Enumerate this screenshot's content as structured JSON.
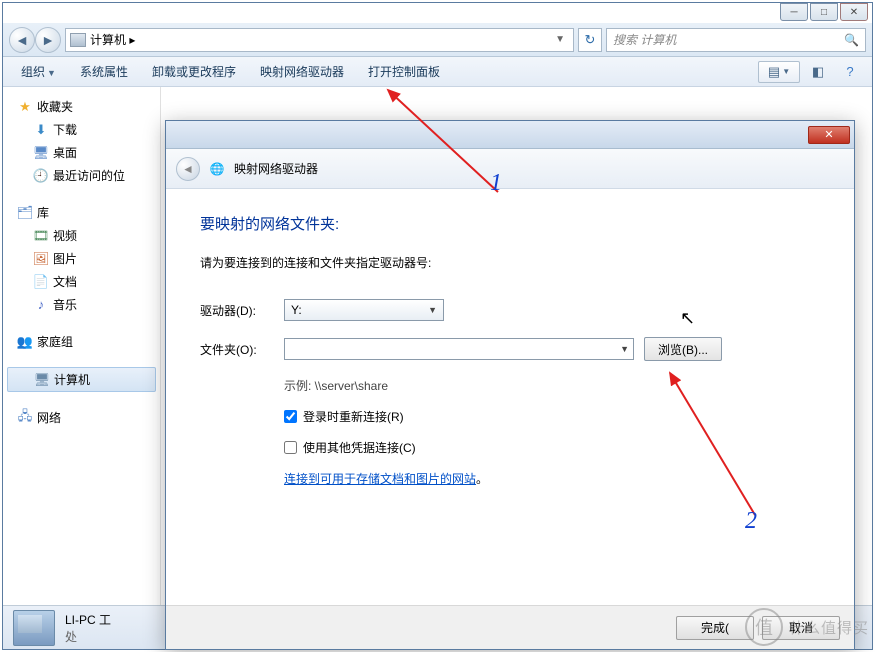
{
  "explorer": {
    "addr_icon_label": "计算机",
    "addr_text": "计算机 ▸",
    "search_placeholder": "搜索 计算机",
    "toolbar": {
      "organize": "组织",
      "properties": "系统属性",
      "uninstall": "卸载或更改程序",
      "mapdrive": "映射网络驱动器",
      "controlpanel": "打开控制面板"
    },
    "sidebar": {
      "favorites": "收藏夹",
      "downloads": "下载",
      "desktop": "桌面",
      "recent": "最近访问的位",
      "libraries": "库",
      "videos": "视频",
      "pictures": "图片",
      "documents": "文档",
      "music": "音乐",
      "homegroup": "家庭组",
      "computer": "计算机",
      "network": "网络"
    },
    "status": {
      "name": "LI-PC 工",
      "sub": "处"
    }
  },
  "dialog": {
    "header_title": "映射网络驱动器",
    "heading": "要映射的网络文件夹:",
    "instruction": "请为要连接到的连接和文件夹指定驱动器号:",
    "drive_label": "驱动器(D):",
    "drive_value": "Y:",
    "folder_label": "文件夹(O):",
    "folder_value": "",
    "browse": "浏览(B)...",
    "example": "示例: \\\\server\\share",
    "reconnect_label": "登录时重新连接(R)",
    "reconnect_checked": true,
    "othercred_label": "使用其他凭据连接(C)",
    "othercred_checked": false,
    "link_text": "连接到可用于存储文档和图片的网站",
    "link_suffix": "。",
    "finish": "完成(",
    "cancel": "取消"
  },
  "annotations": {
    "num1": "1",
    "num2": "2"
  },
  "watermark": {
    "symbol": "值",
    "text": "什么值得买"
  }
}
